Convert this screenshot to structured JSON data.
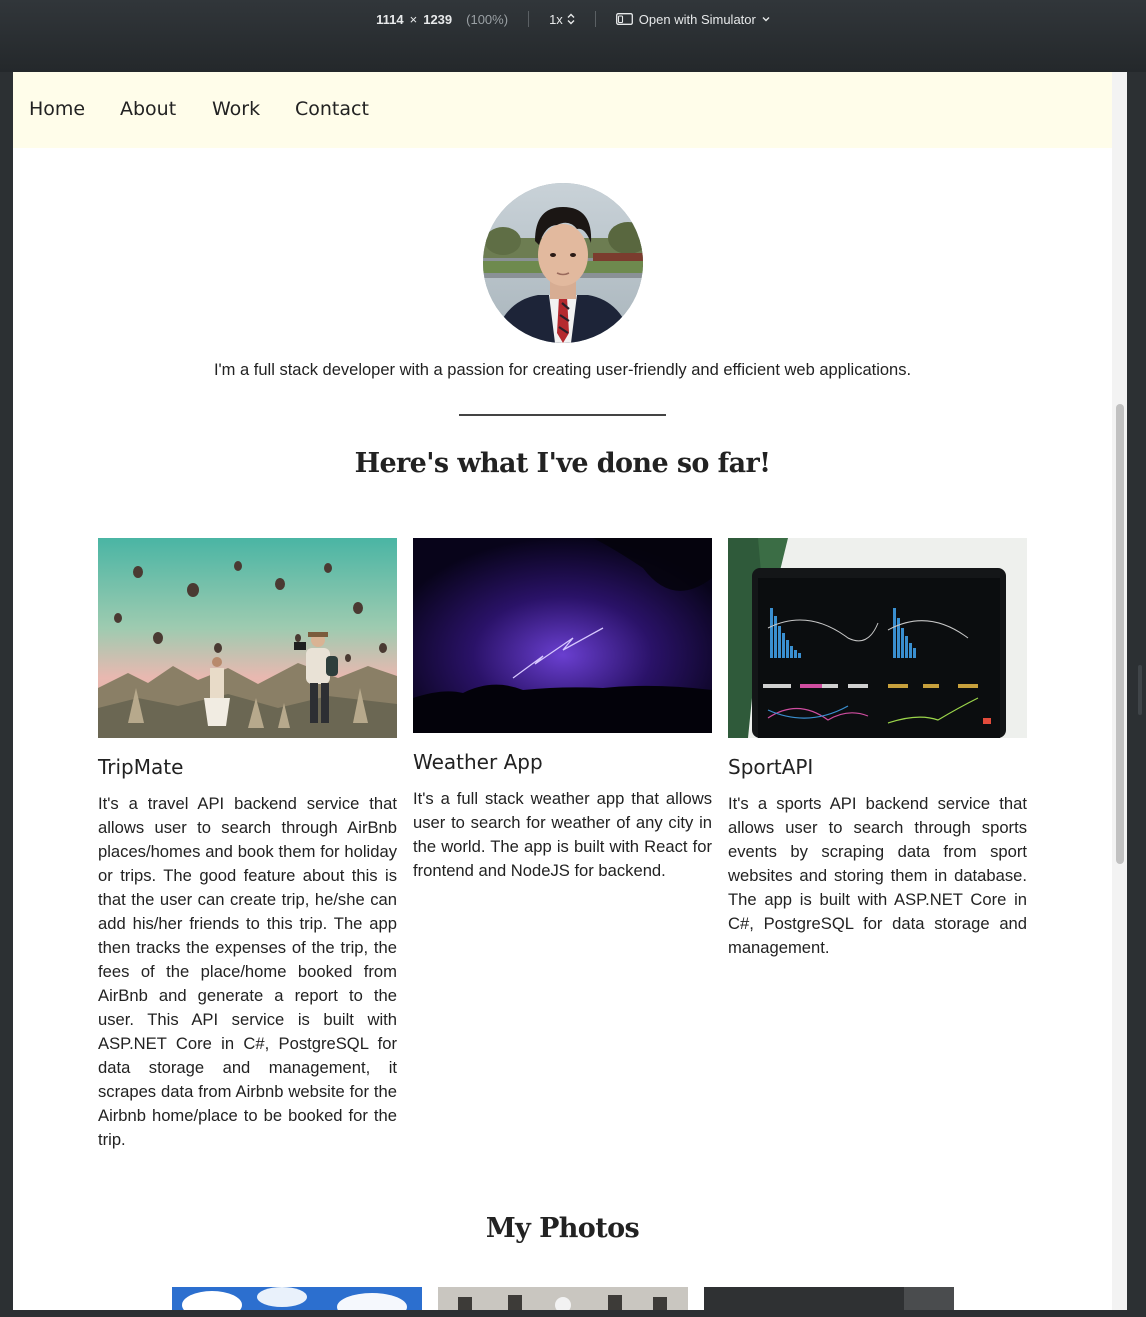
{
  "devtools": {
    "width": "1114",
    "times": "×",
    "height": "1239",
    "zoom_pct": "(100%)",
    "scale": "1x",
    "open_with": "Open with Simulator",
    "icons": [
      "device-icon",
      "updown-arrows-icon",
      "chevron-down-icon"
    ]
  },
  "nav": {
    "items": [
      {
        "label": "Home"
      },
      {
        "label": "About"
      },
      {
        "label": "Work"
      },
      {
        "label": "Contact"
      }
    ]
  },
  "profile": {
    "intro": "I'm a full stack developer with a passion for creating user-friendly and efficient web applications."
  },
  "work": {
    "heading": "Here's what I've done so far!",
    "projects": [
      {
        "title": "TripMate",
        "description": "It's a travel API backend service that allows user to search through AirBnb places/homes and book them for holiday or trips. The good feature about this is that the user can create trip, he/she can add his/her friends to this trip. The app then tracks the expenses of the trip, the fees of the place/home booked from AirBnb and generate a report to the user. This API service is built with ASP.NET Core in C#, PostgreSQL for data storage and management, it scrapes data from Airbnb website for the Airbnb home/place to be booked for the trip."
      },
      {
        "title": "Weather App",
        "description": "It's a full stack weather app that allows user to search for weather of any city in the world. The app is built with React for frontend and NodeJS for backend."
      },
      {
        "title": "SportAPI",
        "description": "It's a sports API backend service that allows user to search through sports events by scraping data from sport websites and storing them in database. The app is built with ASP.NET Core in C#, PostgreSQL for data storage and management."
      }
    ]
  },
  "photos": {
    "heading": "My Photos"
  },
  "colors": {
    "nav_bg": "#fffdea",
    "devtools_bg": "#2c3033",
    "text": "#222222"
  }
}
